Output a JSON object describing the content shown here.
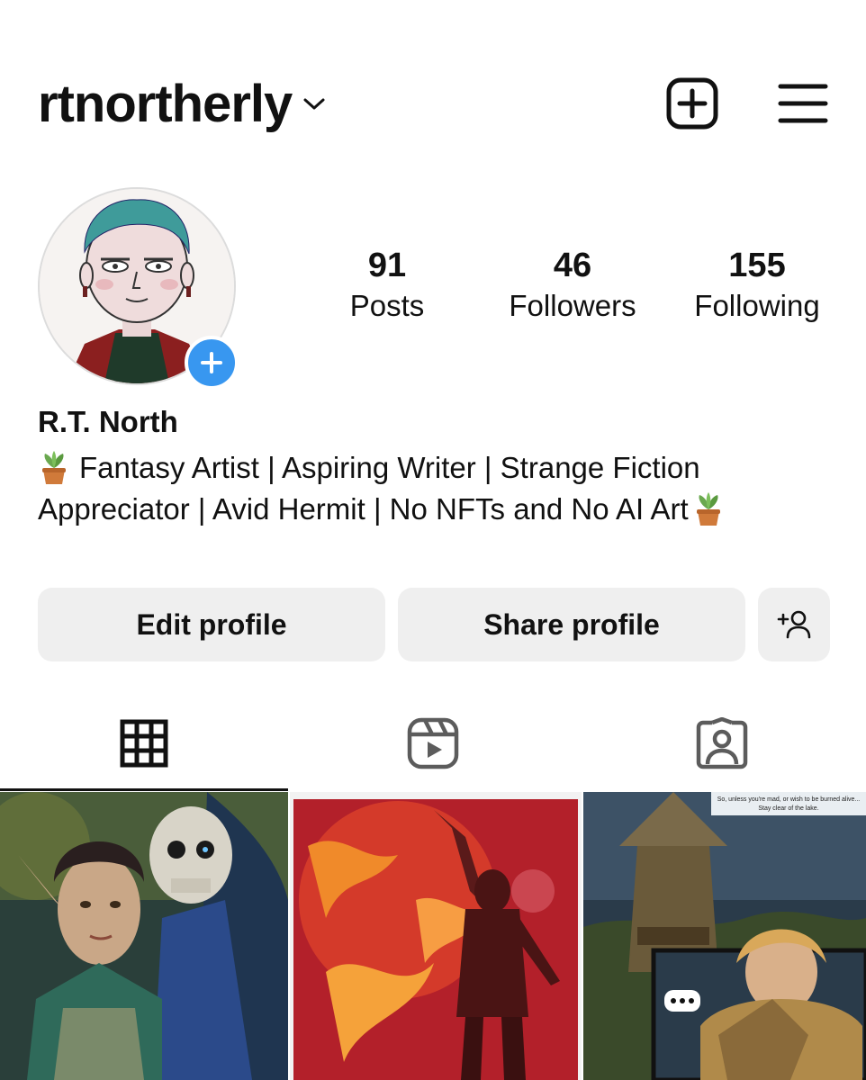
{
  "header": {
    "username": "rtnortherly",
    "switch_account_icon": "chevron-down-icon",
    "new_post_icon": "plus-square-icon",
    "menu_icon": "hamburger-menu-icon"
  },
  "profile": {
    "avatar_icon": "avatar",
    "add_story_icon": "plus-icon",
    "display_name": "R.T. North",
    "bio_line_1": "Fantasy Artist | Aspiring Writer | Strange Fiction",
    "bio_line_2": "Appreciator | Avid Hermit | No NFTs and No AI Art",
    "bio_emoji": "potted-plant-icon"
  },
  "stats": [
    {
      "value": "91",
      "label": "Posts"
    },
    {
      "value": "46",
      "label": "Followers"
    },
    {
      "value": "155",
      "label": "Following"
    }
  ],
  "actions": {
    "edit_label": "Edit profile",
    "share_label": "Share profile",
    "discover_icon": "add-person-icon"
  },
  "tabs": [
    {
      "name": "grid",
      "icon": "grid-icon",
      "active": true
    },
    {
      "name": "reels",
      "icon": "reels-icon",
      "active": false
    },
    {
      "name": "tagged",
      "icon": "tagged-person-icon",
      "active": false
    }
  ],
  "grid_posts": [
    {
      "preview": "elf woman and skeleton illustration"
    },
    {
      "preview": "figure raising arm before red fire"
    },
    {
      "preview": "comic panel with armored knight"
    }
  ],
  "post_3_caption_line_1": "So, unless you're mad, or wish to be burned alive...",
  "post_3_caption_line_2": "Stay clear of the lake.",
  "colors": {
    "accent_blue": "#3897f0",
    "button_bg": "#efefef",
    "text": "#111111",
    "icon_gray": "#5c5c5c"
  }
}
